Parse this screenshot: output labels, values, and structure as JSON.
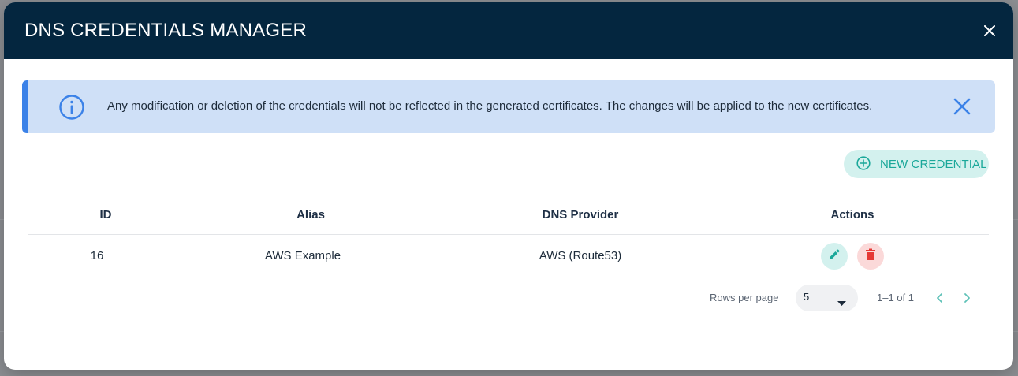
{
  "dialog": {
    "title": "DNS CREDENTIALS MANAGER",
    "close_icon": "close-icon"
  },
  "alert": {
    "icon": "info-icon",
    "message": "Any modification or deletion of the credentials will not be reflected in the generated certificates. The changes will be applied to the new certificates.",
    "close_icon": "close-icon",
    "accent_color": "#3b82e8",
    "background_color": "#cfe0f7"
  },
  "actions": {
    "new_credential_label": "NEW CREDENTIAL",
    "new_credential_icon": "plus-circle-icon"
  },
  "table": {
    "columns": [
      "ID",
      "Alias",
      "DNS Provider",
      "Actions"
    ],
    "rows": [
      {
        "id": "16",
        "alias": "AWS Example",
        "dns_provider": "AWS (Route53)"
      }
    ]
  },
  "pagination": {
    "rows_per_page_label": "Rows per page",
    "rows_per_page_value": "5",
    "range": "1–1 of 1"
  },
  "colors": {
    "header_bg": "#04263f",
    "teal_accent": "#1aa89a",
    "delete_red": "#e53935"
  }
}
